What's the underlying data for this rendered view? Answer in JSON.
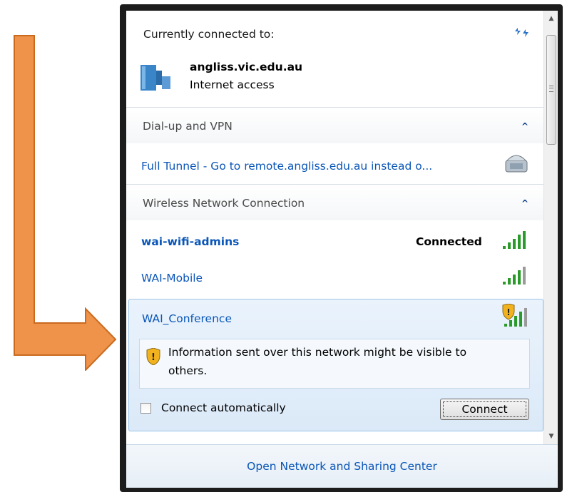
{
  "connected": {
    "heading": "Currently connected to:",
    "network_name": "angliss.vic.edu.au",
    "status": "Internet access"
  },
  "dialup": {
    "section_label": "Dial-up and VPN",
    "item_label": "Full Tunnel - Go to remote.angliss.edu.au instead o..."
  },
  "wireless": {
    "section_label": "Wireless Network Connection",
    "networks": [
      {
        "name": "wai-wifi-admins",
        "status": "Connected"
      },
      {
        "name": "WAI-Mobile"
      },
      {
        "name": "WAI_Conference"
      }
    ],
    "warning_text_line1": "Information sent over this network might be visible to",
    "warning_text_line2": "others.",
    "auto_connect_label": "Connect automatically",
    "connect_button": "Connect"
  },
  "footer": {
    "link": "Open Network and Sharing Center"
  },
  "colors": {
    "arrow": "#f0934a",
    "arrow_border": "#c96a1f",
    "link": "#0a56b8"
  }
}
